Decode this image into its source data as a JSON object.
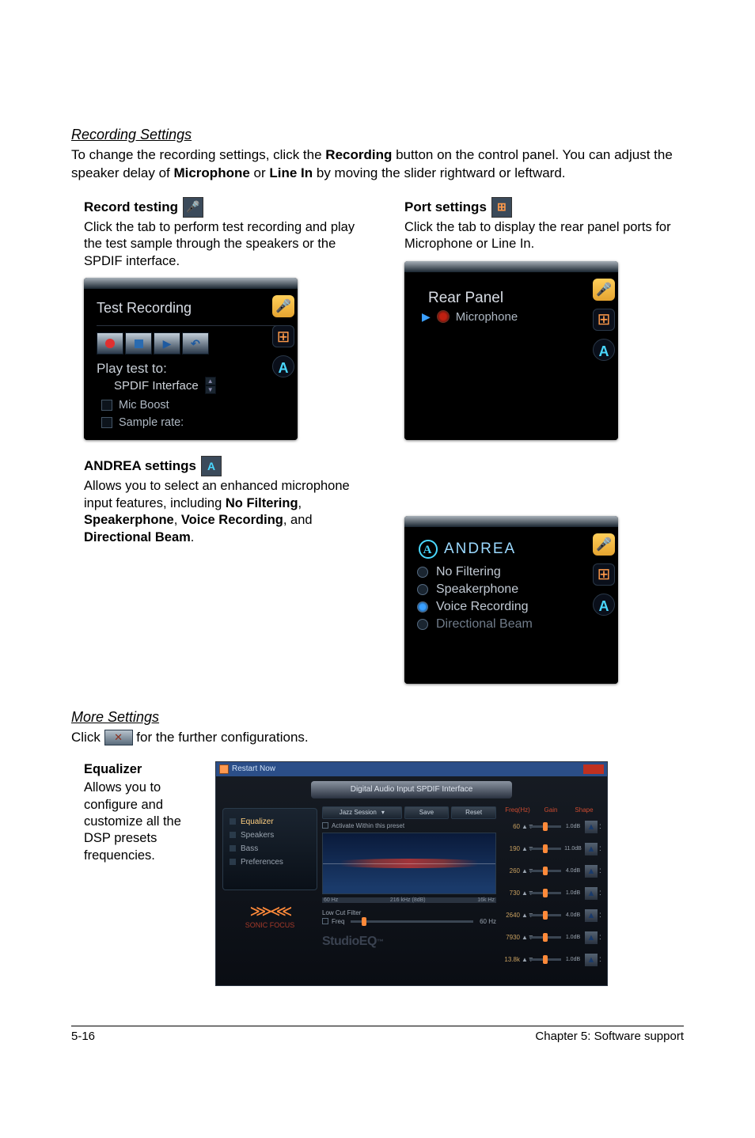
{
  "section1": {
    "title": "Recording Settings",
    "intro_pre": "To change the recording settings, click the ",
    "intro_b1": "Recording",
    "intro_mid1": " button on the control panel. You can adjust the speaker delay of ",
    "intro_b2": "Microphone",
    "intro_mid2": " or ",
    "intro_b3": "Line In",
    "intro_post": " by moving the slider rightward or leftward."
  },
  "recordTesting": {
    "heading": "Record testing",
    "desc": "Click the tab to perform test recording and play the test sample through the speakers or the SPDIF interface.",
    "panelTitle": "Test Recording",
    "playTest": "Play test to:",
    "spdif": "SPDIF Interface",
    "micBoost": "Mic Boost",
    "sampleRate": "Sample rate:"
  },
  "portSettings": {
    "heading": "Port settings",
    "desc": "Click the tab to display the rear panel ports for Microphone or Line In.",
    "panelTitle": "Rear Panel",
    "item": "Microphone"
  },
  "andrea": {
    "heading": "ANDREA settings",
    "desc_pre": "Allows you to select an enhanced microphone input features, including ",
    "b1": "No Filtering",
    "sep1": ", ",
    "b2": "Speakerphone",
    "sep2": ", ",
    "b3": "Voice Recording",
    "sep3": ", and ",
    "b4": "Directional Beam",
    "post": ".",
    "brand": "ANDREA",
    "opts": [
      "No Filtering",
      "Speakerphone",
      "Voice Recording",
      "Directional Beam"
    ]
  },
  "more": {
    "title": "More Settings",
    "pre": "Click ",
    "post": " for the further configurations."
  },
  "equalizer": {
    "heading": "Equalizer",
    "desc": "Allows you to configure and customize all the DSP presets frequencies.",
    "titlebar": "Restart Now",
    "tab": "Digital Audio Input SPDIF Interface",
    "nav": [
      "Equalizer",
      "Speakers",
      "Bass",
      "Preferences"
    ],
    "sonic": "SONIC FOCUS",
    "preset": "Jazz Session",
    "save": "Save",
    "reset": "Reset",
    "activate": "Activate Within this preset",
    "curveLeft": "60 Hz",
    "curveMid": "216 kHz (8dB)",
    "curveRight": "16k Hz",
    "lowcut": "Low Cut Filter",
    "freq": "Freq",
    "hz": "60 Hz",
    "studio1": "Studio",
    "studio2": "EQ",
    "tm": "™",
    "cols": [
      "Freq(Hz)",
      "Gain",
      "Shape"
    ],
    "rows": [
      {
        "f": "60",
        "g": "1.0dB"
      },
      {
        "f": "190",
        "g": "11.0dB"
      },
      {
        "f": "260",
        "g": "4.0dB"
      },
      {
        "f": "730",
        "g": "1.0dB"
      },
      {
        "f": "2640",
        "g": "4.0dB"
      },
      {
        "f": "7930",
        "g": "1.0dB"
      },
      {
        "f": "13.8k",
        "g": "1.0dB"
      }
    ]
  },
  "footer": {
    "left": "5-16",
    "right": "Chapter 5: Software support"
  },
  "glyphs": {
    "mic": "🎤",
    "grid": "⊞",
    "a": "A",
    "play": "▶",
    "undo": "↶",
    "up": "▲",
    "down": "▼",
    "dropdown": "▾",
    "tool": "✕",
    "tri": "▲",
    "colon": ":"
  }
}
